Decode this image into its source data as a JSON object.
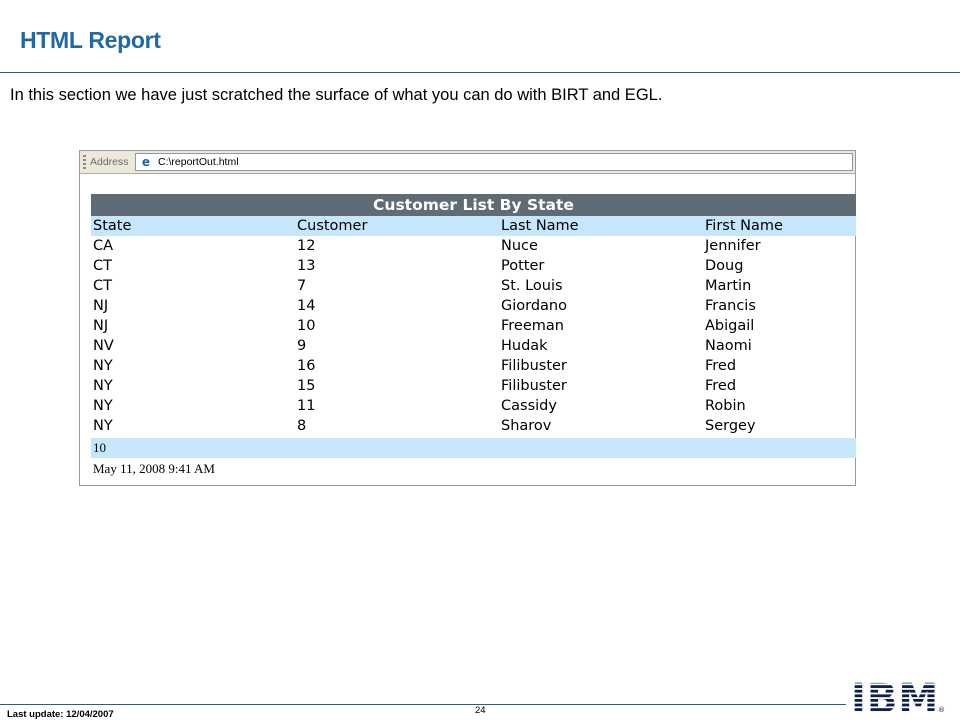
{
  "slide": {
    "title": "HTML Report",
    "intro": "In this section we have just scratched the surface of what you can do with BIRT and EGL."
  },
  "browser": {
    "address_label": "Address",
    "address_value": "C:\\reportOut.html",
    "icon": "ie-page-icon"
  },
  "report": {
    "title": "Customer List By State",
    "headers": [
      "State",
      "Customer",
      "Last Name",
      "First Name"
    ],
    "rows": [
      [
        "CA",
        "12",
        "Nuce",
        "Jennifer"
      ],
      [
        "CT",
        "13",
        "Potter",
        "Doug"
      ],
      [
        "CT",
        "7",
        "St. Louis",
        "Martin"
      ],
      [
        "NJ",
        "14",
        "Giordano",
        "Francis"
      ],
      [
        "NJ",
        "10",
        "Freeman",
        "Abigail"
      ],
      [
        "NV",
        "9",
        "Hudak",
        "Naomi"
      ],
      [
        "NY",
        "16",
        "Filibuster",
        "Fred"
      ],
      [
        "NY",
        "15",
        "Filibuster",
        "Fred"
      ],
      [
        "NY",
        "11",
        "Cassidy",
        "Robin"
      ],
      [
        "NY",
        "8",
        "Sharov",
        "Sergey"
      ]
    ],
    "count": "10",
    "timestamp": "May 11, 2008 9:41 AM"
  },
  "footer": {
    "last_update": "Last update: 12/04/2007",
    "page_number": "24",
    "logo": "IBM"
  },
  "colors": {
    "title_blue": "#1f6aa5",
    "rule": "#2b5d8c",
    "report_title_bg": "#5f6b75",
    "header_bg": "#c6e7fb"
  }
}
